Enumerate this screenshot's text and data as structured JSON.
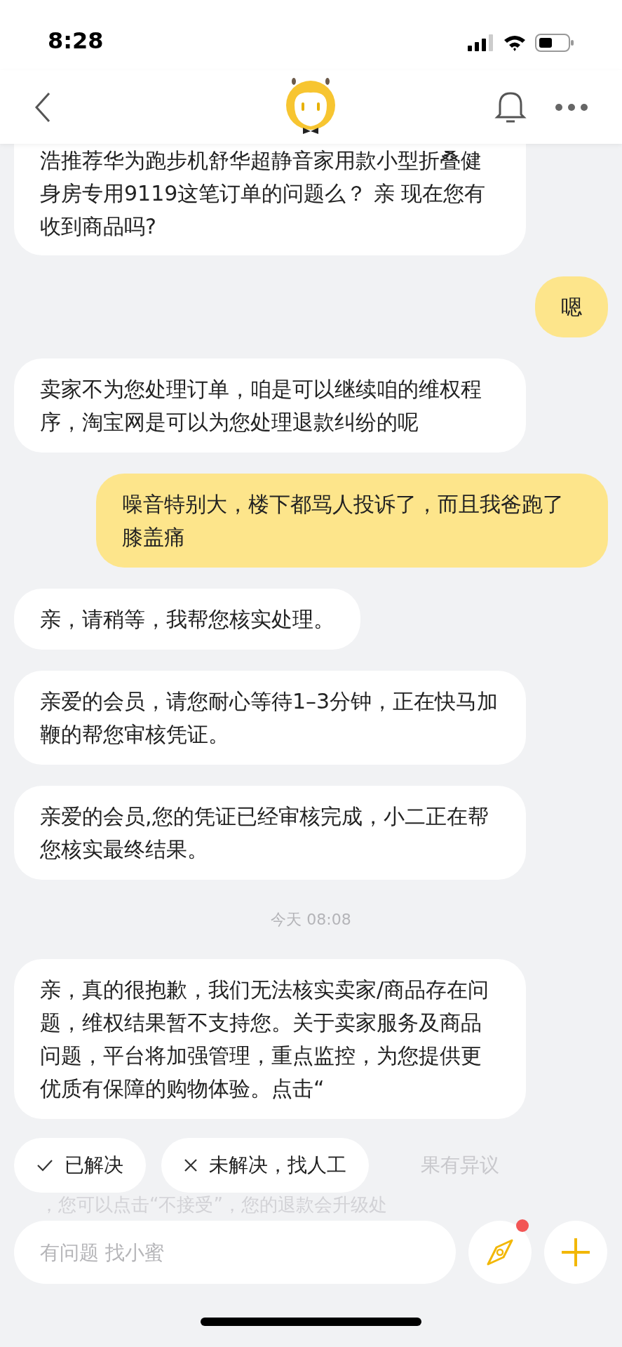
{
  "status_bar": {
    "time": "8:28"
  },
  "messages": [
    {
      "kind": "assistant",
      "cut_top": true,
      "text": "浩推荐华为跑步机舒华超静音家用款小型折叠健身房专用9119这笔订单的问题么？ 亲 现在您有收到商品吗?"
    },
    {
      "kind": "user",
      "cut_top": false,
      "text": "嗯"
    },
    {
      "kind": "assistant",
      "cut_top": false,
      "text": "卖家不为您处理订单，咱是可以继续咱的维权程序，淘宝网是可以为您处理退款纠纷的呢"
    },
    {
      "kind": "user",
      "cut_top": false,
      "text": "噪音特别大，楼下都骂人投诉了，而且我爸跑了膝盖痛"
    },
    {
      "kind": "assistant",
      "cut_top": false,
      "text": "亲，请稍等，我帮您核实处理。"
    },
    {
      "kind": "assistant",
      "cut_top": false,
      "text": "亲爱的会员，请您耐心等待1–3分钟，正在快马加鞭的帮您审核凭证。"
    },
    {
      "kind": "assistant",
      "cut_top": false,
      "text": "亲爱的会员,您的凭证已经审核完成，小二正在帮您核实最终结果。"
    },
    {
      "kind": "time",
      "text": "今天 08:08"
    },
    {
      "kind": "assistant",
      "cut_top": false,
      "text": "亲，真的很抱歉，我们无法核实卖家/商品存在问题，维权结果暂不支持您。关于卖家服务及商品问题，平台将加强管理，重点监控，为您提供更优质有保障的购物体验。点击“"
    }
  ],
  "faded_text": [
    "果有异议",
    "，您可以点击“不接受”，您的退款会升级处"
  ],
  "quick_replies": [
    {
      "kind": "check",
      "label": "已解决"
    },
    {
      "kind": "close",
      "label": "未解决，找人工"
    }
  ],
  "input": {
    "placeholder": "有问题 找小蜜"
  },
  "discover_button": {
    "badge": true
  }
}
